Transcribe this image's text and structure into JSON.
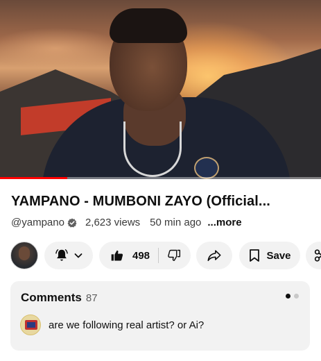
{
  "video": {
    "progress_fraction": 0.21
  },
  "title": "YAMPANO - MUMBONI ZAYO (Official...",
  "meta": {
    "channel": "@yampano",
    "views": "2,623 views",
    "time_ago": "50 min ago",
    "more": "...more"
  },
  "actions": {
    "like_count": "498",
    "save_label": "Save",
    "icons": [
      "bell-icon",
      "chevron-down-icon",
      "thumbs-up-icon",
      "thumbs-down-icon",
      "share-icon",
      "bookmark-icon",
      "scissors-icon"
    ]
  },
  "comments": {
    "title": "Comments",
    "count": "87",
    "first_comment": "are we following real artist? or Ai?"
  },
  "colors": {
    "progress": "#ff0000",
    "pill_bg": "#f2f2f2",
    "dot_active": "#0f0f0f",
    "dot_inactive": "#c9c9c9"
  }
}
